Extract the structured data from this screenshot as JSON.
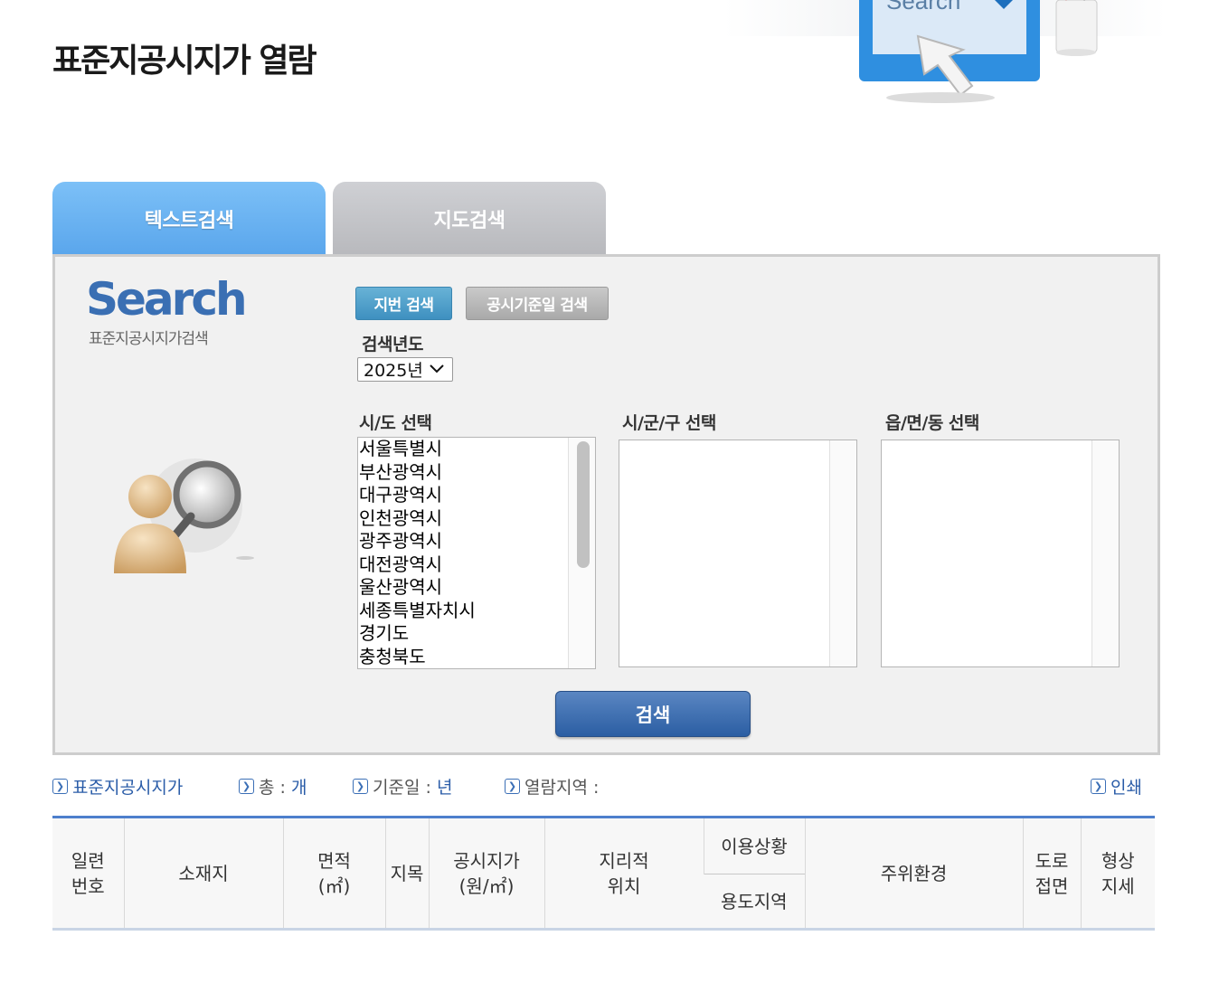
{
  "page": {
    "title": "표준지공시지가 열람"
  },
  "tabs": [
    {
      "label": "텍스트검색",
      "active": true
    },
    {
      "label": "지도검색",
      "active": false
    }
  ],
  "search_panel": {
    "logo_word": "Search",
    "logo_sub": "표준지공시지가검색",
    "sub_buttons": {
      "parcel": "지번 검색",
      "date": "공시기준일 검색"
    },
    "year": {
      "label": "검색년도",
      "selected": "2025년"
    },
    "lists": {
      "sido": {
        "label": "시/도 선택",
        "options": [
          "서울특별시",
          "부산광역시",
          "대구광역시",
          "인천광역시",
          "광주광역시",
          "대전광역시",
          "울산광역시",
          "세종특별자치시",
          "경기도",
          "충청북도"
        ]
      },
      "sigungu": {
        "label": "시/군/구 선택",
        "options": []
      },
      "eupmyeondong": {
        "label": "읍/면/동 선택",
        "options": []
      }
    },
    "search_button": "검색"
  },
  "info_bar": {
    "standard_price": "표준지공시지가",
    "total_label": "총 :",
    "total_unit": "개",
    "base_date_label": "기준일 :",
    "base_date_unit": "년",
    "region_label": "열람지역 :",
    "print": "인쇄"
  },
  "table": {
    "serial": "일련\n번호",
    "location": "소재지",
    "area": "면적\n(㎡)",
    "land_category": "지목",
    "price": "공시지가\n(원/㎡)",
    "geo_position": "지리적\n위치",
    "usage_status": "이용상황",
    "zoning": "용도지역",
    "surroundings": "주위환경",
    "road_contact": "도로\n접면",
    "shape_terrain": "형상\n지세"
  },
  "colors": {
    "tab_active": "#6bb4f2",
    "tab_inactive": "#c4c5c9",
    "primary_blue": "#2a5ca8",
    "panel_bg": "#f1f1f1"
  }
}
